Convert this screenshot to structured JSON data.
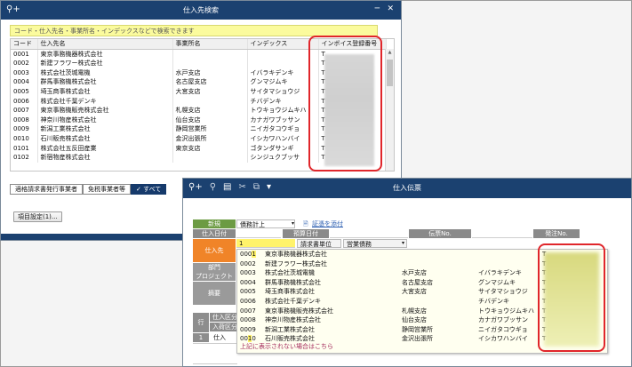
{
  "search_window": {
    "title": "仕入先検索",
    "search_placeholder": "コード・仕入先名・事業所名・インデックスなどで検索できます",
    "columns": [
      "コード",
      "仕入先名",
      "事業所名",
      "インデックス",
      "インボイス登録番号"
    ],
    "rows": [
      {
        "code": "0001",
        "name": "東京事務機器株式会社",
        "office": "",
        "index": "",
        "invoice": "T"
      },
      {
        "code": "0002",
        "name": "新建フラワー株式会社",
        "office": "",
        "index": "",
        "invoice": "T"
      },
      {
        "code": "0003",
        "name": "株式会社茨城電機",
        "office": "水戸支店",
        "index": "イバラキデンキ",
        "invoice": "T"
      },
      {
        "code": "0004",
        "name": "群馬事務機株式会社",
        "office": "名古屋支店",
        "index": "グンマジムキ",
        "invoice": "T"
      },
      {
        "code": "0005",
        "name": "埼玉商事株式会社",
        "office": "大宮支店",
        "index": "サイタマショウジ",
        "invoice": "T"
      },
      {
        "code": "0006",
        "name": "株式会社千葉デンキ",
        "office": "",
        "index": "チバデンキ",
        "invoice": "T"
      },
      {
        "code": "0007",
        "name": "東京事務機販売株式会社",
        "office": "札幌支店",
        "index": "トウキョウジムキハ",
        "invoice": "T"
      },
      {
        "code": "0008",
        "name": "神奈川物産株式会社",
        "office": "仙台支店",
        "index": "カナガワブッサン",
        "invoice": "T"
      },
      {
        "code": "0009",
        "name": "新潟工業株式会社",
        "office": "静岡営業所",
        "index": "ニイガタコウギョ",
        "invoice": "T"
      },
      {
        "code": "0010",
        "name": "石川販売株式会社",
        "office": "金沢出張所",
        "index": "イシカワハンバイ",
        "invoice": "T"
      },
      {
        "code": "0101",
        "name": "株式会社五反田産業",
        "office": "東京支店",
        "index": "ゴタンダサンギ",
        "invoice": "T"
      },
      {
        "code": "0102",
        "name": "新宿物産株式会社",
        "office": "",
        "index": "シンジュクブッサ",
        "invoice": "T"
      }
    ],
    "filters": [
      {
        "label": "適格請求書発行事業者",
        "selected": false
      },
      {
        "label": "免税事業者等",
        "selected": false
      },
      {
        "label": "✓ すべて",
        "selected": true
      }
    ],
    "settings_button": "項目設定(1)..."
  },
  "slip_window": {
    "title": "仕入伝票",
    "toolbar_icons": [
      "search-icon",
      "zoom-icon",
      "print-icon",
      "scissors-icon",
      "copy-icon",
      "dropdown-icon"
    ],
    "new_label": "新規",
    "mode_value": "債務計上",
    "attach_link": "証憑を添付",
    "labels": {
      "purchase_date": "仕入日付",
      "scheduled_date": "預算日付",
      "slip_no": "伝票No.",
      "order_no": "発注No.",
      "supplier": "仕入先",
      "department": "部門",
      "project": "プロジェクト",
      "summary": "摘要",
      "row": "行",
      "purchase_section": "仕入区分",
      "stock_section": "入荷区分",
      "row1": "1",
      "row1_kind": "仕入"
    },
    "supplier_input": "1",
    "billing_unit": "請求書単位",
    "business_debt": "営業債務",
    "dropdown_rows": [
      {
        "code": "0001",
        "name": "東京事務機器株式会社",
        "office": "",
        "index": "",
        "invoice": "T"
      },
      {
        "code": "0002",
        "name": "新建フラワー株式会社",
        "office": "",
        "index": "",
        "invoice": "T"
      },
      {
        "code": "0003",
        "name": "株式会社茨城電機",
        "office": "水戸支店",
        "index": "イバラキデンキ",
        "invoice": "T"
      },
      {
        "code": "0004",
        "name": "群馬事務機株式会社",
        "office": "名古屋支店",
        "index": "グンマジムキ",
        "invoice": "T"
      },
      {
        "code": "0005",
        "name": "埼玉商事株式会社",
        "office": "大宮支店",
        "index": "サイタマショウジ",
        "invoice": "T"
      },
      {
        "code": "0006",
        "name": "株式会社千葉デンキ",
        "office": "",
        "index": "チバデンキ",
        "invoice": "T"
      },
      {
        "code": "0007",
        "name": "東京事務機販売株式会社",
        "office": "札幌支店",
        "index": "トウキョウジムキハ",
        "invoice": "T"
      },
      {
        "code": "0008",
        "name": "神奈川物産株式会社",
        "office": "仙台支店",
        "index": "カナガワブッサン",
        "invoice": "T"
      },
      {
        "code": "0009",
        "name": "新潟工業株式会社",
        "office": "静岡営業所",
        "index": "ニイガタコウギョ",
        "invoice": "T"
      },
      {
        "code": "0010",
        "name": "石川販売株式会社",
        "office": "金沢出張所",
        "index": "イシカワハンバイ",
        "invoice": "T"
      }
    ],
    "dropdown_note": "上記に表示されない場合はこちら"
  },
  "colors": {
    "titlebar": "#1b4170",
    "search_bg": "#fbfb9d",
    "highlight": "#e0262b",
    "new_green": "#6c9b43",
    "supplier_orange": "#f08428"
  }
}
